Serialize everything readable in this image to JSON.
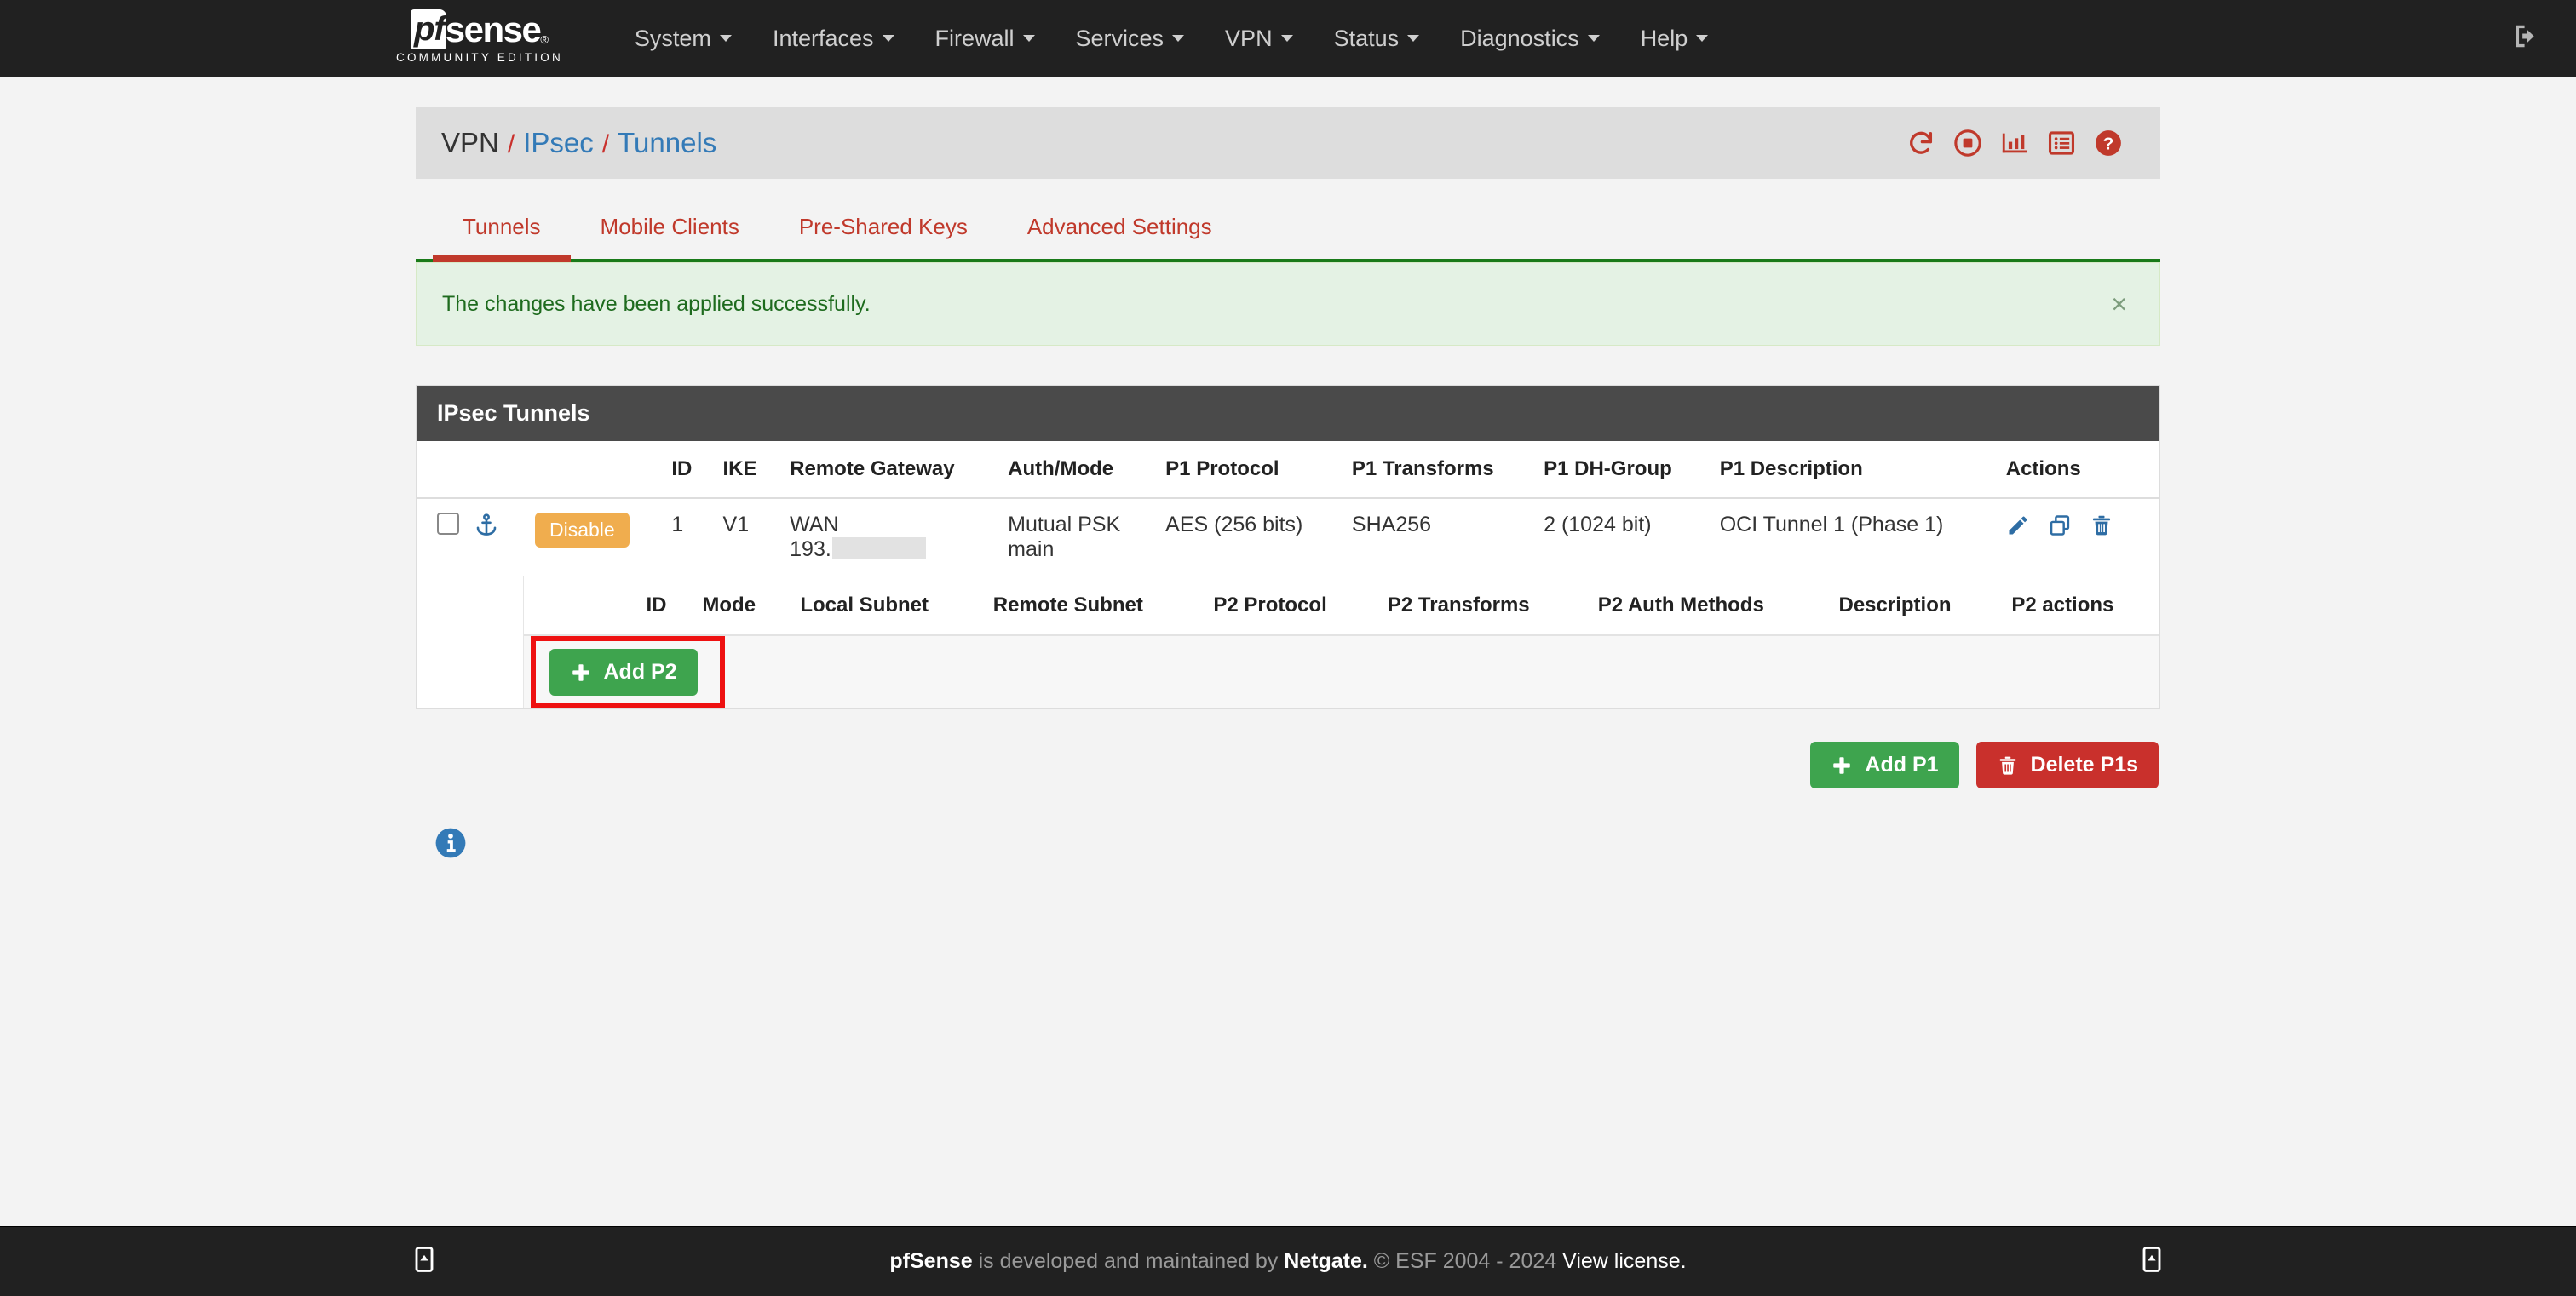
{
  "navbar": {
    "brand_pf": "pf",
    "brand_sense": "sense",
    "brand_sub": "COMMUNITY EDITION",
    "items": [
      {
        "label": "System"
      },
      {
        "label": "Interfaces"
      },
      {
        "label": "Firewall"
      },
      {
        "label": "Services"
      },
      {
        "label": "VPN"
      },
      {
        "label": "Status"
      },
      {
        "label": "Diagnostics"
      },
      {
        "label": "Help"
      }
    ],
    "logout_icon": "logout-icon"
  },
  "breadcrumb": {
    "root": "VPN",
    "sep": "/",
    "level1": "IPsec",
    "level2": "Tunnels"
  },
  "header_icons": [
    {
      "name": "restart-service-icon"
    },
    {
      "name": "stop-service-icon"
    },
    {
      "name": "status-graph-icon"
    },
    {
      "name": "log-list-icon"
    },
    {
      "name": "help-icon"
    }
  ],
  "tabs": [
    {
      "label": "Tunnels",
      "active": true
    },
    {
      "label": "Mobile Clients",
      "active": false
    },
    {
      "label": "Pre-Shared Keys",
      "active": false
    },
    {
      "label": "Advanced Settings",
      "active": false
    }
  ],
  "alert": {
    "message": "The changes have been applied successfully.",
    "close": "×",
    "color": "#1e6b1e"
  },
  "panel": {
    "title": "IPsec Tunnels",
    "columns": [
      "ID",
      "IKE",
      "Remote Gateway",
      "Auth/Mode",
      "P1 Protocol",
      "P1 Transforms",
      "P1 DH-Group",
      "P1 Description",
      "Actions"
    ],
    "row": {
      "status_badge": "Disable",
      "id": "1",
      "ike": "V1",
      "remote_gateway_line1": "WAN",
      "remote_gateway_line2": "193.",
      "auth_line1": "Mutual PSK",
      "auth_line2": "main",
      "p1_protocol": "AES (256 bits)",
      "p1_transforms": "SHA256",
      "p1_dh_group": "2 (1024 bit)",
      "p1_description": "OCI Tunnel 1 (Phase 1)"
    }
  },
  "p2": {
    "columns": [
      "ID",
      "Mode",
      "Local Subnet",
      "Remote Subnet",
      "P2 Protocol",
      "P2 Transforms",
      "P2 Auth Methods",
      "Description",
      "P2 actions"
    ],
    "add_label": "Add P2"
  },
  "buttons": {
    "add_p1": "Add P1",
    "delete_p1s": "Delete P1s"
  },
  "colors": {
    "accent_red": "#c0392b",
    "success_green": "#3ea44e",
    "danger_red": "#c9302c",
    "warning_orange": "#f0ad4e",
    "link_blue": "#337ab7",
    "highlight_box": "#ee1111"
  },
  "footer": {
    "brand": "pfSense",
    "mid": " is developed and maintained by ",
    "netgate": "Netgate.",
    "copyright": " © ESF 2004 - 2024 ",
    "license": "View license."
  }
}
